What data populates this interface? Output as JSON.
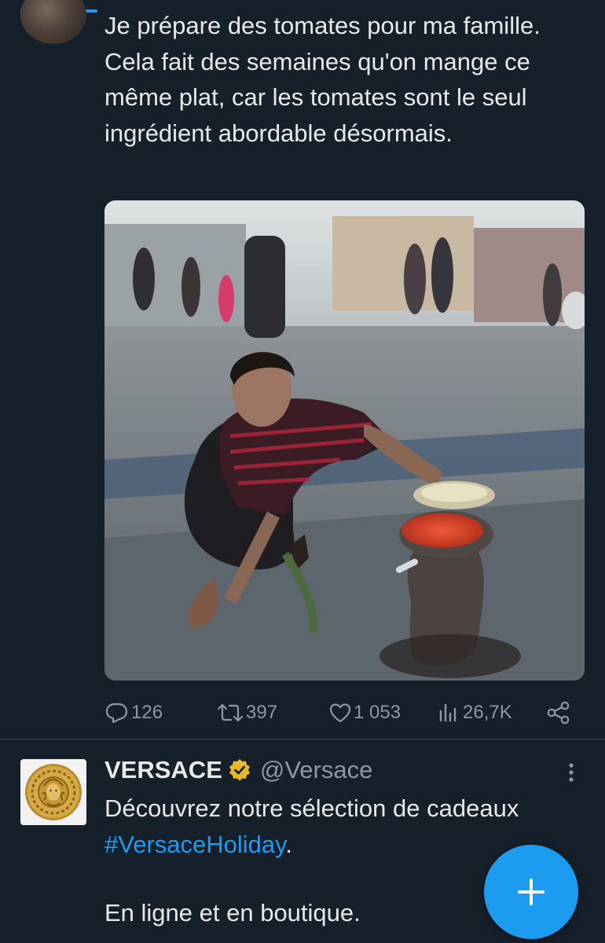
{
  "colors": {
    "background": "#15202b",
    "text": "#e7e9ea",
    "muted": "#8b98a5",
    "accent": "#1d9bf0",
    "verified_gold": "#e8b829"
  },
  "tweet": {
    "text": "Je prépare des tomates pour ma famille. Cela fait des semaines qu'on mange ce même plat, car les tomates sont le seul ingrédient abordable désormais.",
    "media": {
      "type": "video",
      "description_icon": "mute-icon"
    },
    "actions": {
      "replies": "126",
      "retweets": "397",
      "likes": "1 053",
      "views": "26,7K"
    }
  },
  "ad_tweet": {
    "name": "VERSACE",
    "handle": "@Versace",
    "text_line1": "Découvrez notre sélection de cadeaux",
    "hashtag": "#VersaceHoliday",
    "hashtag_suffix": ".",
    "text_line3": "En ligne et en boutique."
  },
  "icons": [
    "reply-icon",
    "retweet-icon",
    "like-icon",
    "views-icon",
    "share-icon",
    "mute-icon",
    "verified-badge-icon",
    "more-icon",
    "compose-plus-icon"
  ]
}
